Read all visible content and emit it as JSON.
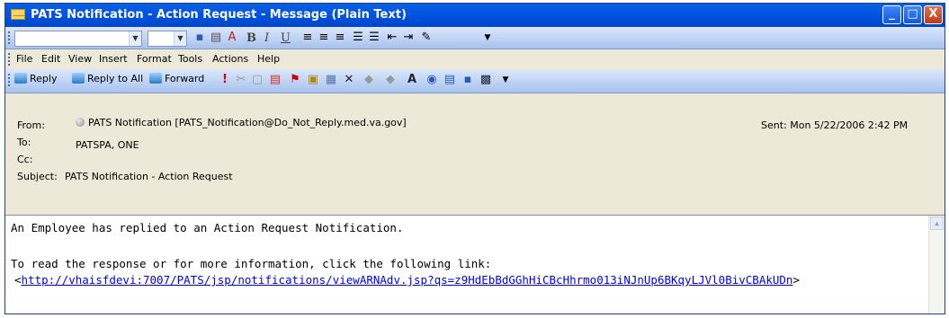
{
  "window": {
    "title": "PATS Notification - Action Request - Message (Plain Text)",
    "min_glyph": "_",
    "max_glyph": "□",
    "close_glyph": "X"
  },
  "format_toolbar": {
    "bold": "B",
    "italic": "I",
    "underline": "U"
  },
  "menu": {
    "items": [
      "File",
      "Edit",
      "View",
      "Insert",
      "Format",
      "Tools",
      "Actions",
      "Help"
    ]
  },
  "actions_toolbar": {
    "reply": "Reply",
    "reply_all": "Reply to All",
    "forward": "Forward"
  },
  "header": {
    "from_label": "From:",
    "from_value": "PATS Notification [PATS_Notification@Do_Not_Reply.med.va.gov]",
    "sent_value": "Sent: Mon 5/22/2006 2:42 PM",
    "to_label": "To:",
    "to_value": "PATSPA, ONE",
    "cc_label": "Cc:",
    "cc_value": "",
    "subject_label": "Subject:",
    "subject_value": "PATS Notification - Action Request"
  },
  "body": {
    "line1": "An Employee has replied to an Action Request Notification.",
    "line2": "To read the response or for more information, click the following link:",
    "link_open": "<",
    "link": "http://vhaisfdevi:7007/PATS/jsp/notifications/viewARNAdv.jsp?qs=z9HdEbBdGGhHiCBcHhrmo013iNJnUp6BKqyLJVl0BivCBAkUDn",
    "link_close": ">"
  },
  "colors": {
    "titlebar": "#0054e3",
    "chrome": "#ece9d8",
    "link": "#0000ee"
  }
}
